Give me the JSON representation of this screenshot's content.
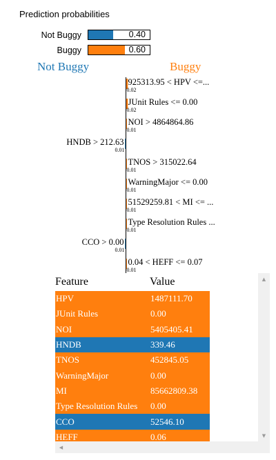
{
  "title": "Prediction probabilities",
  "probabilities": [
    {
      "label": "Not Buggy",
      "value": 0.4,
      "display": "0.40",
      "color": "#1f77b4"
    },
    {
      "label": "Buggy",
      "value": 0.6,
      "display": "0.60",
      "color": "#ff7f0e"
    }
  ],
  "class_names": {
    "negative": "Not Buggy",
    "positive": "Buggy"
  },
  "colors": {
    "not_buggy": "#1f77b4",
    "buggy": "#ff7f0e"
  },
  "chart_data": {
    "type": "bar",
    "orientation": "horizontal",
    "categories": [
      "925313.95 < HPV <=...",
      "JUnit Rules <= 0.00",
      "NOI > 4864864.86",
      "HNDB > 212.63",
      "TNOS > 315022.64",
      "WarningMajor <= 0.00",
      "51529259.81 < MI <= ...",
      "Type Resolution Rules ...",
      "CCO > 0.00",
      "0.04 < HEFF <= 0.07"
    ],
    "series": [
      {
        "name": "Buggy",
        "values": [
          0.02,
          0.02,
          0.01,
          null,
          0.01,
          0.01,
          0.01,
          0.01,
          null,
          0.01
        ]
      },
      {
        "name": "Not Buggy",
        "values": [
          null,
          null,
          null,
          0.01,
          null,
          null,
          null,
          null,
          0.01,
          null
        ]
      }
    ],
    "value_labels": [
      "0.02",
      "0.02",
      "0.01",
      "0.01",
      "0.01",
      "0.01",
      "0.01",
      "0.01",
      "0.01",
      "0.01"
    ],
    "sides": [
      "Buggy",
      "Buggy",
      "Buggy",
      "Not Buggy",
      "Buggy",
      "Buggy",
      "Buggy",
      "Buggy",
      "Not Buggy",
      "Buggy"
    ]
  },
  "table": {
    "headers": [
      "Feature",
      "Value"
    ],
    "rows": [
      {
        "feature": "HPV",
        "value": "1487111.70",
        "side": "Buggy"
      },
      {
        "feature": "JUnit Rules",
        "value": "0.00",
        "side": "Buggy"
      },
      {
        "feature": "NOI",
        "value": "5405405.41",
        "side": "Buggy"
      },
      {
        "feature": "HNDB",
        "value": "339.46",
        "side": "Not Buggy"
      },
      {
        "feature": "TNOS",
        "value": "452845.05",
        "side": "Buggy"
      },
      {
        "feature": "WarningMajor",
        "value": "0.00",
        "side": "Buggy"
      },
      {
        "feature": "MI",
        "value": "85662809.38",
        "side": "Buggy"
      },
      {
        "feature": "Type Resolution Rules",
        "value": "0.00",
        "side": "Buggy"
      },
      {
        "feature": "CCO",
        "value": "52546.10",
        "side": "Not Buggy"
      },
      {
        "feature": "HEFF",
        "value": "0.06",
        "side": "Buggy"
      }
    ]
  }
}
